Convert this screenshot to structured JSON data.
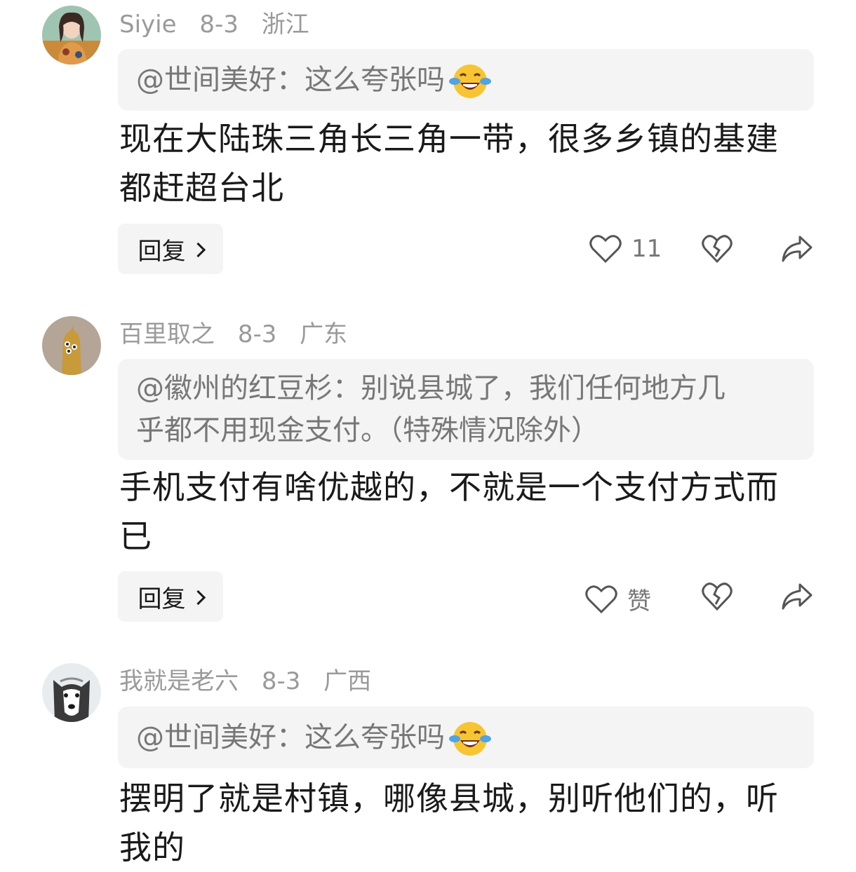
{
  "colors": {
    "meta_text": "#9a9a9a",
    "quote_bg": "#f4f4f4",
    "quote_text": "#777777",
    "body_text": "#1a1a1a",
    "icon": "#555555"
  },
  "comments": [
    {
      "username": "Siyie",
      "date": "8-3",
      "location": "浙江",
      "quote": "@世间美好：这么夸张吗",
      "quote_emoji": "laughing-crying-emoji",
      "body_line1": "现在大陆珠三角长三角一带，很多乡镇的基建",
      "body_line2": "都赶超台北",
      "reply_label": "回复",
      "like_label": "11"
    },
    {
      "username": "百里取之",
      "date": "8-3",
      "location": "广东",
      "quote_line1": "@徽州的红豆杉：别说县城了，我们任何地方几",
      "quote_line2": "乎都不用现金支付。（特殊情况除外）",
      "body_line1": "手机支付有啥优越的，不就是一个支付方式而",
      "body_line2": "已",
      "reply_label": "回复",
      "like_label": "赞"
    },
    {
      "username": "我就是老六",
      "date": "8-3",
      "location": "广西",
      "quote": "@世间美好：这么夸张吗",
      "quote_emoji": "laughing-crying-emoji",
      "body_line1": "摆明了就是村镇，哪像县城，别听他们的，听",
      "body_line2": "我的"
    }
  ]
}
